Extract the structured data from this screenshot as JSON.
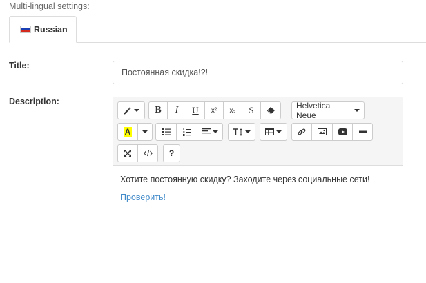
{
  "settings": {
    "section_label": "Multi-lingual settings:"
  },
  "tabs": [
    {
      "label": "Russian",
      "icon": "russian-flag-icon"
    }
  ],
  "fields": {
    "title": {
      "label": "Title:",
      "value": "Постоянная скидка!?!"
    },
    "description": {
      "label": "Description:"
    }
  },
  "toolbar": {
    "font_name": "Helvetica Neue",
    "bold": "B",
    "italic": "I",
    "underline": "U",
    "superscript": "x²",
    "subscript": "x₂",
    "strikethrough": "S",
    "color_letter": "A",
    "help": "?",
    "icons": [
      "magic-icon",
      "bold-icon",
      "italic-icon",
      "underline-icon",
      "superscript-icon",
      "subscript-icon",
      "strikethrough-icon",
      "eraser-icon",
      "font-color-icon",
      "unordered-list-icon",
      "ordered-list-icon",
      "align-icon",
      "line-height-icon",
      "table-icon",
      "link-icon",
      "picture-icon",
      "video-icon",
      "horizontal-rule-icon",
      "fullscreen-icon",
      "code-view-icon",
      "help-icon"
    ]
  },
  "editor": {
    "paragraph": "Хотите постоянную скидку? Заходите через социальные сети!",
    "link_text": "Проверить!"
  },
  "colors": {
    "link": "#428bca",
    "highlight": "#ffff00"
  }
}
